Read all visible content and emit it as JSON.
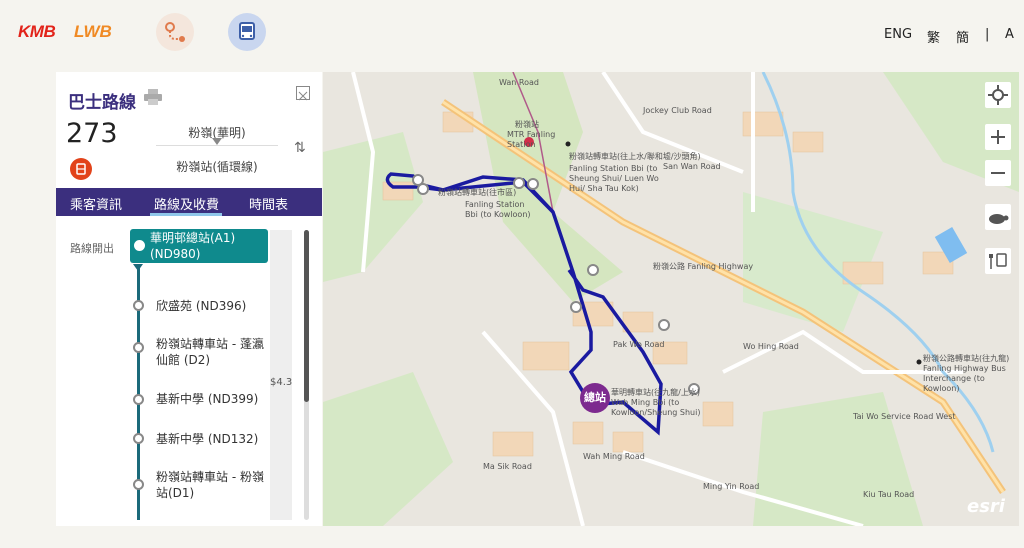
{
  "header": {
    "logo_kmb": "KMB",
    "logo_lwb": "LWB",
    "icons": [
      "route-planner-icon",
      "bus-route-icon"
    ],
    "lang_eng": "ENG",
    "lang_tc": "繁",
    "lang_sc": "簡",
    "sep": "|",
    "font_size": "A"
  },
  "panel": {
    "title": "巴士路線",
    "route_number": "273",
    "from": "粉嶺(華明)",
    "to": "粉嶺站(循環線)",
    "tabs": [
      "乘客資訊",
      "路線及收費",
      "時間表"
    ],
    "direction_label": "路線開出",
    "fare": "$4.3",
    "stops": [
      "華明邨總站(A1) (ND980)",
      "欣盛苑 (ND396)",
      "粉嶺站轉車站 - 蓬瀛仙館 (D2)",
      "基新中學 (ND399)",
      "基新中學 (ND132)",
      "粉嶺站轉車站 - 粉嶺站(D1)"
    ]
  },
  "map": {
    "terminal_badge": "總站",
    "labels": [
      {
        "text": "Wan Road"
      },
      {
        "text": "粉嶺站"
      },
      {
        "text": "MTR Fanling Station"
      },
      {
        "text": "粉嶺站轉車站(往上水/聯和墟/沙頭角)"
      },
      {
        "text": "Fanling Station Bbi (to Sheung Shui/ Luen Wo Hui/ Sha Tau Kok)"
      },
      {
        "text": "粉嶺站轉車站(往市區)"
      },
      {
        "text": "Fanling Station Bbi (to Kowloon)"
      },
      {
        "text": "粉嶺公路 Fanling Highway"
      },
      {
        "text": "華明轉車站(往九龍/上水)"
      },
      {
        "text": "Wah Ming Bbi (to Kowloon/Sheung Shui)"
      },
      {
        "text": "粉嶺公路轉車站(往九龍)"
      },
      {
        "text": "Fanling Highway Bus Interchange (to Kowloon)"
      },
      {
        "text": "Jockey Club Road"
      },
      {
        "text": "San Wan Road"
      },
      {
        "text": "Pak Wo Road"
      },
      {
        "text": "Wah Ming Road"
      },
      {
        "text": "Wo Hing Road"
      },
      {
        "text": "Ma Sik Road"
      },
      {
        "text": "Kiu Tau Road"
      },
      {
        "text": "Ming Yin Road"
      },
      {
        "text": "Tai Wo Service Road West"
      }
    ],
    "esri": "esri"
  },
  "colors": {
    "brand_purple": "#3b2f7e",
    "teal": "#0f8a8d",
    "route_blue": "#1a1aa0",
    "kmb_red": "#e2231a"
  }
}
